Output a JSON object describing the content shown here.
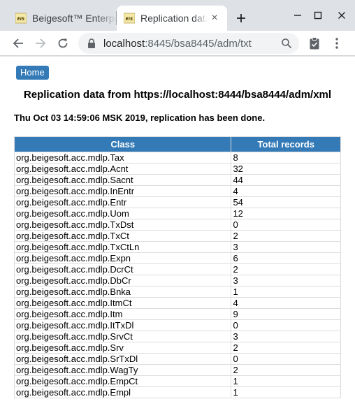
{
  "browser": {
    "tabs": [
      {
        "title": "Beigesoft™ Enterprise Information System",
        "active": false
      },
      {
        "title": "Replication data",
        "active": true
      }
    ],
    "favicon_text": "EIS",
    "url_host": "localhost",
    "url_rest": ":8445/bsa8445/adm/txt",
    "new_tab_label": "+",
    "close_glyph": "×"
  },
  "page": {
    "home_label": "Home",
    "title": "Replication data from https://localhost:8444/bsa8444/adm/xml",
    "status": "Thu Oct 03 14:59:06 MSK 2019, replication has been done.",
    "table": {
      "headers": [
        "Class",
        "Total records"
      ],
      "rows": [
        [
          "org.beigesoft.acc.mdlp.Tax",
          "8"
        ],
        [
          "org.beigesoft.acc.mdlp.Acnt",
          "32"
        ],
        [
          "org.beigesoft.acc.mdlp.Sacnt",
          "44"
        ],
        [
          "org.beigesoft.acc.mdlp.InEntr",
          "4"
        ],
        [
          "org.beigesoft.acc.mdlp.Entr",
          "54"
        ],
        [
          "org.beigesoft.acc.mdlp.Uom",
          "12"
        ],
        [
          "org.beigesoft.acc.mdlp.TxDst",
          "0"
        ],
        [
          "org.beigesoft.acc.mdlp.TxCt",
          "2"
        ],
        [
          "org.beigesoft.acc.mdlp.TxCtLn",
          "3"
        ],
        [
          "org.beigesoft.acc.mdlp.Expn",
          "6"
        ],
        [
          "org.beigesoft.acc.mdlp.DcrCt",
          "2"
        ],
        [
          "org.beigesoft.acc.mdlp.DbCr",
          "3"
        ],
        [
          "org.beigesoft.acc.mdlp.Bnka",
          "1"
        ],
        [
          "org.beigesoft.acc.mdlp.ItmCt",
          "4"
        ],
        [
          "org.beigesoft.acc.mdlp.Itm",
          "9"
        ],
        [
          "org.beigesoft.acc.mdlp.ItTxDl",
          "0"
        ],
        [
          "org.beigesoft.acc.mdlp.SrvCt",
          "3"
        ],
        [
          "org.beigesoft.acc.mdlp.Srv",
          "2"
        ],
        [
          "org.beigesoft.acc.mdlp.SrTxDl",
          "0"
        ],
        [
          "org.beigesoft.acc.mdlp.WagTy",
          "2"
        ],
        [
          "org.beigesoft.acc.mdlp.EmpCt",
          "1"
        ],
        [
          "org.beigesoft.acc.mdlp.Empl",
          "1"
        ]
      ]
    }
  },
  "colors": {
    "accent": "#337ab7",
    "tabstrip": "#dee1e6",
    "omnibox": "#f1f3f4"
  },
  "icons": [
    "eis-favicon-icon",
    "close-icon",
    "plus-icon",
    "minimize-icon",
    "maximize-icon",
    "window-close-icon",
    "back-arrow-icon",
    "forward-arrow-icon",
    "reload-icon",
    "lock-icon",
    "zoom-icon",
    "clipboard-icon",
    "kebab-menu-icon"
  ]
}
